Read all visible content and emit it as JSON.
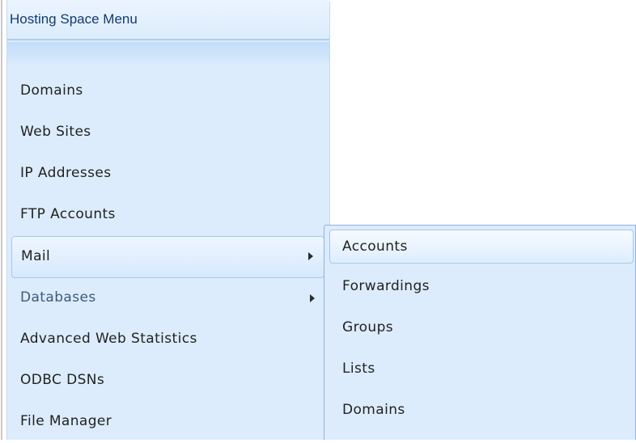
{
  "menu": {
    "title": "Hosting Space Menu",
    "items": [
      {
        "label": "Domains"
      },
      {
        "label": "Web Sites"
      },
      {
        "label": "IP Addresses"
      },
      {
        "label": "FTP Accounts"
      },
      {
        "label": "Mail",
        "has_submenu": true,
        "state": "active"
      },
      {
        "label": "Databases",
        "has_submenu": true
      },
      {
        "label": "Advanced Web Statistics"
      },
      {
        "label": "ODBC DSNs"
      },
      {
        "label": "File Manager"
      }
    ]
  },
  "submenu": {
    "parent": "Mail",
    "items": [
      {
        "label": "Accounts",
        "state": "hover"
      },
      {
        "label": "Forwardings"
      },
      {
        "label": "Groups"
      },
      {
        "label": "Lists"
      },
      {
        "label": "Domains"
      }
    ]
  },
  "icons": {
    "submenu_indicator": "triangle-right-icon"
  },
  "colors": {
    "panel_background": "#dcecfc",
    "title_text": "#123b70",
    "item_text": "#222222",
    "highlight_border": "#a9c8ec"
  }
}
